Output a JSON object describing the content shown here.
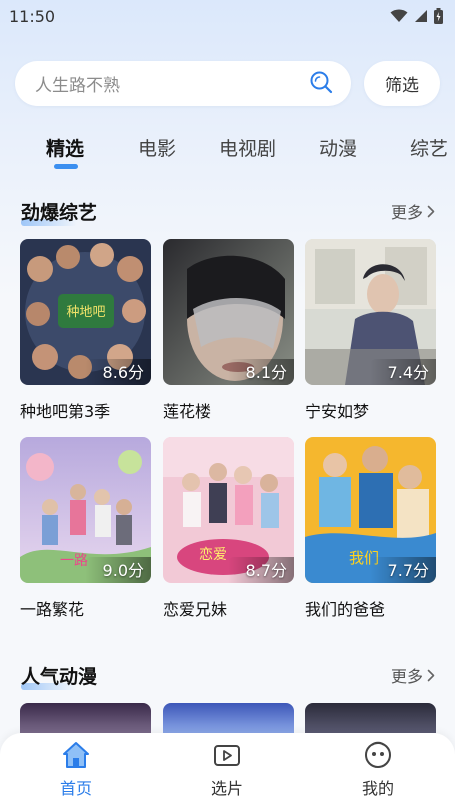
{
  "status_bar": {
    "time": "11:50"
  },
  "search": {
    "placeholder": "人生路不熟",
    "filter_label": "筛选"
  },
  "tabs": [
    {
      "label": "精选",
      "active": true
    },
    {
      "label": "电影"
    },
    {
      "label": "电视剧"
    },
    {
      "label": "动漫"
    },
    {
      "label": "综艺"
    }
  ],
  "sections": [
    {
      "title": "劲爆综艺",
      "more": "更多",
      "items": [
        {
          "title": "种地吧第3季",
          "score": "8.6分"
        },
        {
          "title": "莲花楼",
          "score": "8.1分"
        },
        {
          "title": "宁安如梦",
          "score": "7.4分"
        },
        {
          "title": "一路繁花",
          "score": "9.0分"
        },
        {
          "title": "恋爱兄妹",
          "score": "8.7分"
        },
        {
          "title": "我们的爸爸",
          "score": "7.7分"
        }
      ]
    },
    {
      "title": "人气动漫",
      "more": "更多"
    }
  ],
  "bottom_nav": [
    {
      "label": "首页",
      "icon": "home-icon",
      "active": true
    },
    {
      "label": "选片",
      "icon": "video-icon"
    },
    {
      "label": "我的",
      "icon": "profile-icon"
    }
  ],
  "colors": {
    "accent": "#2b7de9",
    "tab_indicator": "#3b8ff0"
  }
}
